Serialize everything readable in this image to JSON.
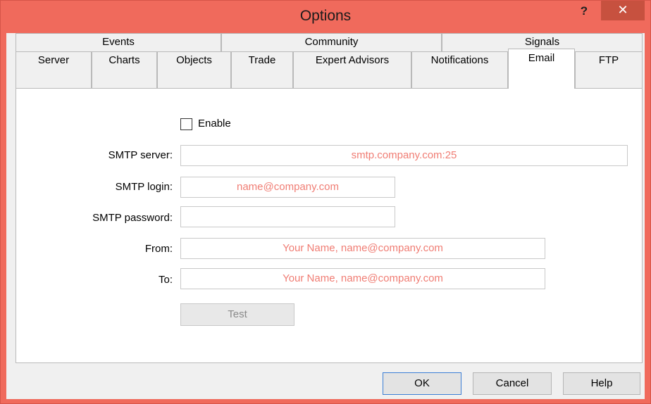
{
  "window": {
    "title": "Options",
    "help_glyph": "?",
    "close_glyph": "✕"
  },
  "tabs_row1": [
    "Events",
    "Community",
    "Signals"
  ],
  "tabs_row2": [
    "Server",
    "Charts",
    "Objects",
    "Trade",
    "Expert Advisors",
    "Notifications",
    "Email",
    "FTP"
  ],
  "active_tab": "Email",
  "email": {
    "enable_label": "Enable",
    "enable_checked": false,
    "smtp_server_label": "SMTP server:",
    "smtp_server_placeholder": "smtp.company.com:25",
    "smtp_login_label": "SMTP login:",
    "smtp_login_placeholder": "name@company.com",
    "smtp_password_label": "SMTP password:",
    "smtp_password_value": "",
    "from_label": "From:",
    "from_placeholder": "Your Name, name@company.com",
    "to_label": "To:",
    "to_placeholder": "Your Name, name@company.com",
    "test_label": "Test"
  },
  "buttons": {
    "ok": "OK",
    "cancel": "Cancel",
    "help": "Help"
  },
  "colors": {
    "titlebar": "#f06a5c",
    "placeholder_text": "#f07d74",
    "close_button": "#c7513f"
  }
}
